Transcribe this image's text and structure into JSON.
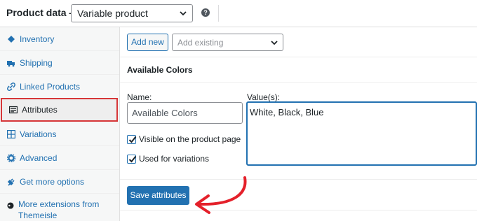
{
  "header": {
    "title": "Product data —",
    "product_type": "Variable product",
    "help_glyph": "?"
  },
  "sidebar": {
    "items": [
      {
        "label": "Inventory",
        "icon": "inventory-icon"
      },
      {
        "label": "Shipping",
        "icon": "truck-icon"
      },
      {
        "label": "Linked Products",
        "icon": "link-icon"
      },
      {
        "label": "Attributes",
        "icon": "attributes-icon",
        "active": true
      },
      {
        "label": "Variations",
        "icon": "grid-icon"
      },
      {
        "label": "Advanced",
        "icon": "gear-icon"
      },
      {
        "label": "Get more options",
        "icon": "plug-icon"
      },
      {
        "label": "More extensions from Themeisle",
        "icon": "themeisle-icon"
      }
    ]
  },
  "main": {
    "add_new_label": "Add new",
    "add_existing_placeholder": "Add existing",
    "attribute_heading": "Available Colors",
    "name_label": "Name:",
    "name_value": "Available Colors",
    "values_label": "Value(s):",
    "values_value": "White, Black, Blue",
    "visible_label": "Visible on the product page",
    "variations_label": "Used for variations",
    "save_label": "Save attributes"
  },
  "colors": {
    "accent": "#2271b1",
    "highlight_border": "#d63638",
    "annotation_arrow": "#e4202a"
  }
}
